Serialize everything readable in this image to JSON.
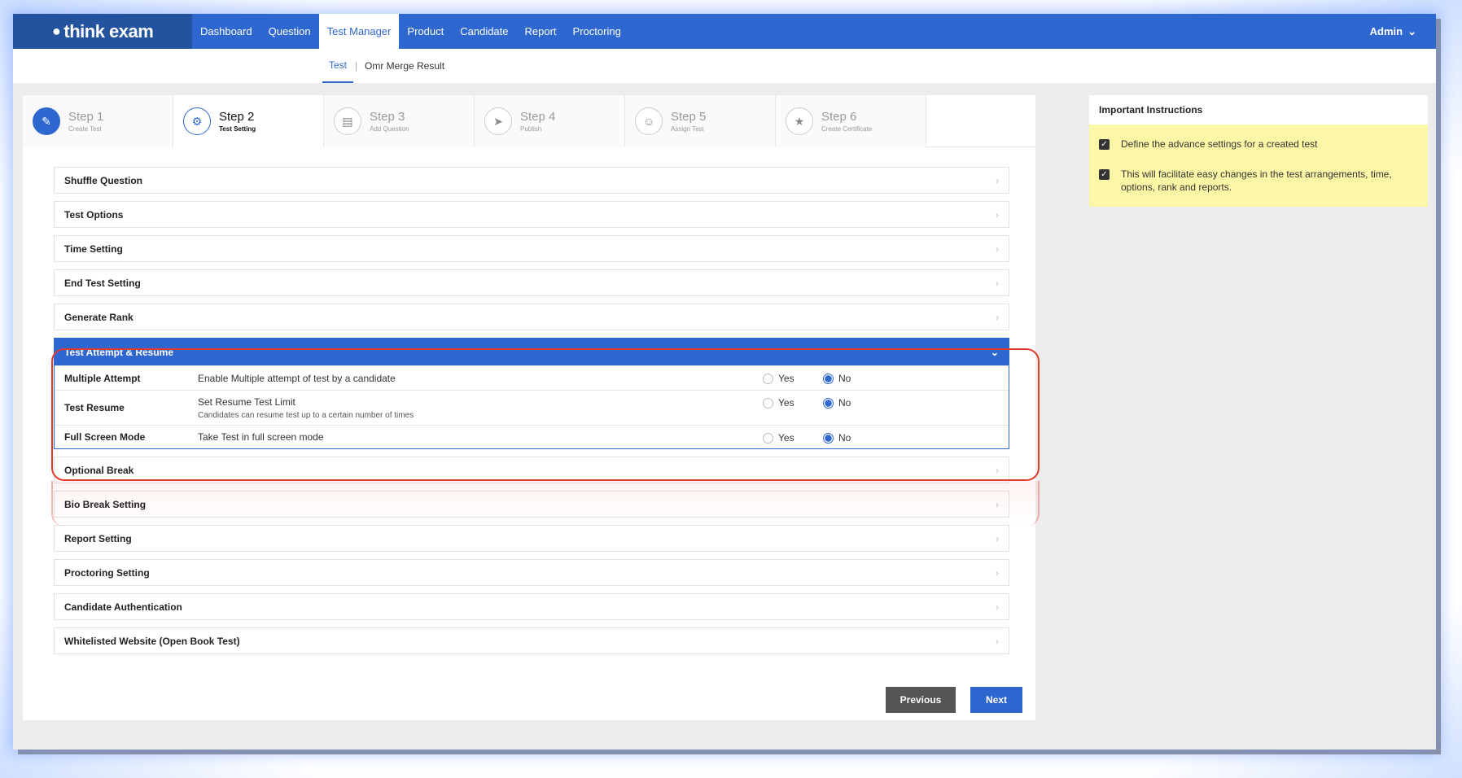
{
  "app": {
    "logo_text": "think exam"
  },
  "nav": {
    "items": [
      {
        "label": "Dashboard",
        "active": false
      },
      {
        "label": "Question",
        "active": false
      },
      {
        "label": "Test Manager",
        "active": true
      },
      {
        "label": "Product",
        "active": false
      },
      {
        "label": "Candidate",
        "active": false
      },
      {
        "label": "Report",
        "active": false
      },
      {
        "label": "Proctoring",
        "active": false
      }
    ],
    "user": "Admin"
  },
  "subnav": {
    "active": "Test",
    "separator": "|",
    "other": "Omr Merge Result"
  },
  "steps": [
    {
      "title": "Step 1",
      "subtitle": "Create Test",
      "icon": "pencil-icon"
    },
    {
      "title": "Step 2",
      "subtitle": "Test Setting",
      "icon": "gear-icon"
    },
    {
      "title": "Step 3",
      "subtitle": "Add Question",
      "icon": "document-icon"
    },
    {
      "title": "Step 4",
      "subtitle": "Publish",
      "icon": "rocket-icon"
    },
    {
      "title": "Step 5",
      "subtitle": "Assign Test",
      "icon": "users-icon"
    },
    {
      "title": "Step 6",
      "subtitle": "Create Certificate",
      "icon": "star-icon"
    }
  ],
  "sections_before": [
    "Shuffle Question",
    "Test Options",
    "Time Setting",
    "End Test Setting",
    "Generate Rank"
  ],
  "open_section": {
    "title": "Test Attempt & Resume",
    "options": [
      {
        "label": "Multiple Attempt",
        "description": "Enable Multiple attempt of test by a candidate",
        "note": "",
        "yes": "Yes",
        "no": "No",
        "selected": "No"
      },
      {
        "label": "Test Resume",
        "description": "Set Resume Test Limit",
        "note": "Candidates can resume test up to a certain number of times",
        "yes": "Yes",
        "no": "No",
        "selected": "No"
      },
      {
        "label": "Full Screen Mode",
        "description": "Take Test in full screen mode",
        "note": "",
        "yes": "Yes",
        "no": "No",
        "selected": "No"
      }
    ]
  },
  "sections_after": [
    "Optional Break",
    "Bio Break Setting",
    "Report Setting",
    "Proctoring Setting",
    "Candidate Authentication",
    "Whitelisted Website (Open Book Test)"
  ],
  "buttons": {
    "previous": "Previous",
    "next": "Next"
  },
  "instructions": {
    "title": "Important Instructions",
    "items": [
      "Define the advance settings for a created test",
      "This will facilitate easy changes in the test arrangements, time, options, rank and reports."
    ]
  },
  "colors": {
    "primary": "#2f67d0",
    "logo_bg": "#23539f",
    "highlight": "#e03c2e",
    "note_bg": "#fbf7a6"
  }
}
